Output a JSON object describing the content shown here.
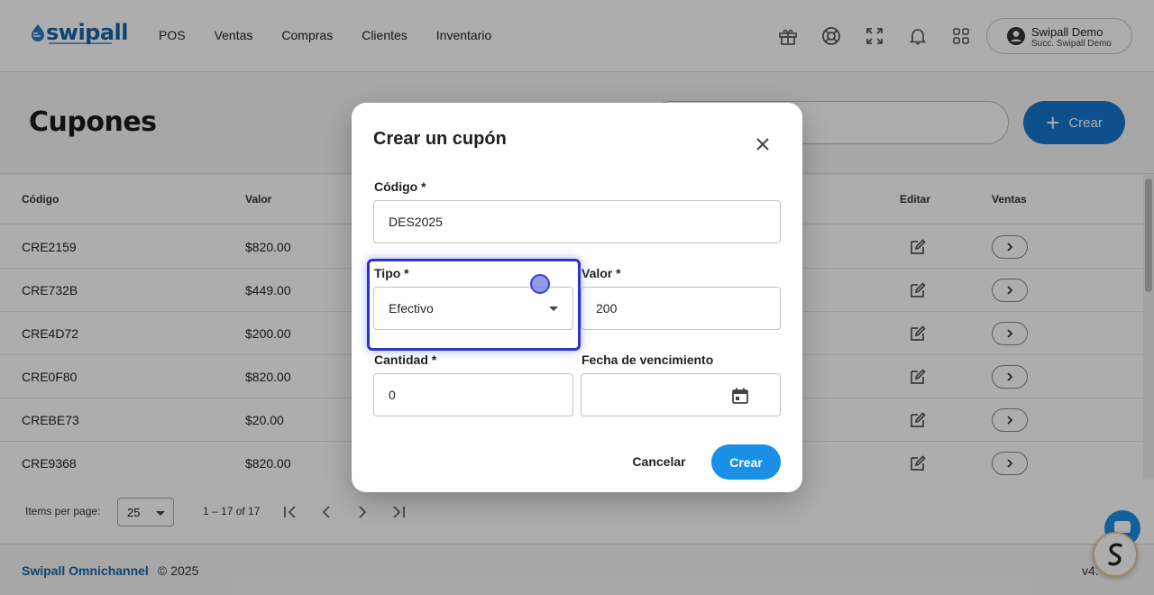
{
  "app": {
    "logo_text": "swipall",
    "nav": [
      "POS",
      "Ventas",
      "Compras",
      "Clientes",
      "Inventario"
    ],
    "user": {
      "name": "Swipall Demo",
      "branch": "Succ. Swipall Demo"
    }
  },
  "page": {
    "title": "Cupones",
    "create_label": "Crear"
  },
  "table": {
    "headers": {
      "code": "Código",
      "value": "Valor",
      "edit": "Editar",
      "sales": "Ventas"
    },
    "rows": [
      {
        "code": "CRE2159",
        "value": "$820.00"
      },
      {
        "code": "CRE732B",
        "value": "$449.00"
      },
      {
        "code": "CRE4D72",
        "value": "$200.00"
      },
      {
        "code": "CRE0F80",
        "value": "$820.00"
      },
      {
        "code": "CREBE73",
        "value": "$20.00"
      },
      {
        "code": "CRE9368",
        "value": "$820.00"
      }
    ]
  },
  "paginator": {
    "items_per_page_label": "Items per page:",
    "items_per_page": "25",
    "range": "1 – 17 of 17"
  },
  "footer": {
    "brand": "Swipall Omnichannel",
    "copyright": "© 2025",
    "version": "v4."
  },
  "dialog": {
    "title": "Crear un cupón",
    "code_label": "Código *",
    "code_value": "DES2025",
    "type_label": "Tipo *",
    "type_value": "Efectivo",
    "value_label": "Valor *",
    "value_value": "200",
    "quantity_label": "Cantidad *",
    "quantity_value": "0",
    "expiry_label": "Fecha de vencimiento",
    "expiry_value": "",
    "cancel_label": "Cancelar",
    "create_label": "Crear"
  },
  "colors": {
    "primary": "#1677cf",
    "button": "#1a8fe6",
    "highlight": "#2d32c8"
  }
}
